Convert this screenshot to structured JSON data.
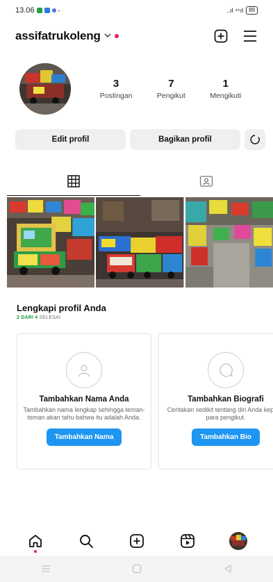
{
  "status_bar": {
    "time": "13.06",
    "network": "..ıl ⁴⁶ıl",
    "battery": "89"
  },
  "header": {
    "username": "assifatrukoleng"
  },
  "profile": {
    "stats": [
      {
        "count": "3",
        "label": "Postingan"
      },
      {
        "count": "7",
        "label": "Pengikut"
      },
      {
        "count": "1",
        "label": "Mengikuti"
      }
    ]
  },
  "actions": {
    "edit": "Edit profil",
    "share": "Bagikan profil"
  },
  "completion": {
    "title": "Lengkapi profil Anda",
    "progress_done": "2 DARI 4",
    "progress_label": "SELESAI",
    "cards": [
      {
        "title": "Tambahkan Nama Anda",
        "desc": "Tambahkan nama lengkap sehingga teman-teman akan tahu bahwa itu adalah Anda.",
        "button": "Tambahkan Nama"
      },
      {
        "title": "Tambahkan Biografi",
        "desc": "Ceritakan sedikit tentang diri Anda kepada para pengikut.",
        "button": "Tambahkan Bio"
      }
    ]
  },
  "colors": {
    "accent": "#1e95f0",
    "notification": "#e0245e",
    "success": "#1a9c3f"
  }
}
